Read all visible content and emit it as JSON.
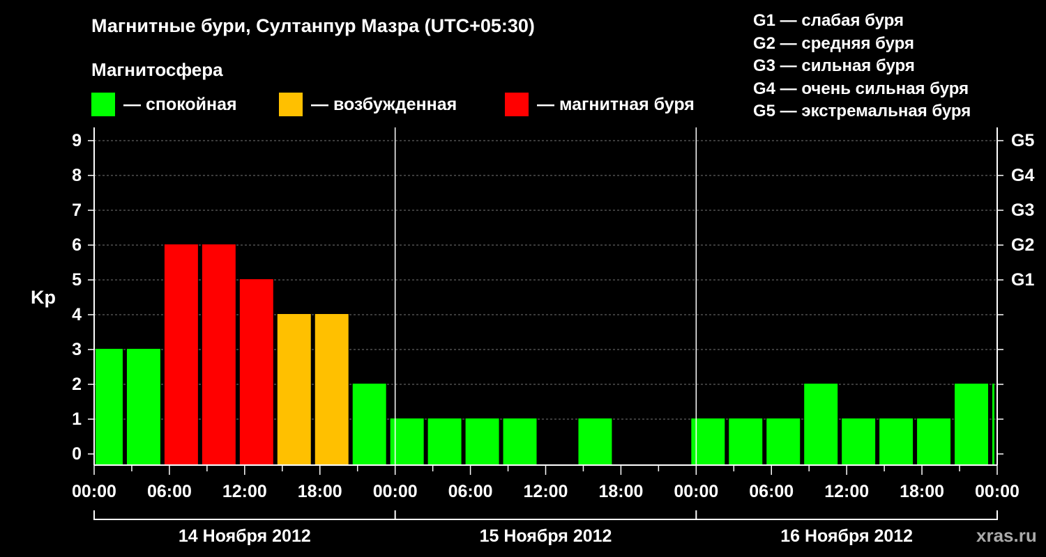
{
  "title": "Магнитные бури, Султанпур Мазра (UTC+05:30)",
  "subtitle": "Магнитосфера",
  "legend": [
    {
      "label": "— спокойная",
      "color": "#00ff00"
    },
    {
      "label": "— возбужденная",
      "color": "#ffc000"
    },
    {
      "label": "— магнитная буря",
      "color": "#ff0000"
    }
  ],
  "g_legend": [
    "G1 — слабая буря",
    "G2 — средняя буря",
    "G3 — сильная буря",
    "G4 — очень сильная буря",
    "G5 — экстремальная буря"
  ],
  "watermark": "xras.ru",
  "chart_data": {
    "type": "bar",
    "ylabel": "Kp",
    "ylim": [
      0,
      9
    ],
    "y_ticks": [
      "0",
      "1",
      "2",
      "3",
      "4",
      "5",
      "6",
      "7",
      "8",
      "9"
    ],
    "g_ticks": [
      {
        "label": "G1",
        "kp": 5
      },
      {
        "label": "G2",
        "kp": 6
      },
      {
        "label": "G3",
        "kp": 7
      },
      {
        "label": "G4",
        "kp": 8
      },
      {
        "label": "G5",
        "kp": 9
      }
    ],
    "x_ticks": [
      "00:00",
      "06:00",
      "12:00",
      "18:00",
      "00:00",
      "06:00",
      "12:00",
      "18:00",
      "00:00",
      "06:00",
      "12:00",
      "18:00",
      "00:00"
    ],
    "days": [
      "14 Ноября 2012",
      "15 Ноября 2012",
      "16 Ноября 2012"
    ],
    "hours_total": 72,
    "bars": [
      {
        "start": 0,
        "end": 2.5,
        "value": 3,
        "level": "quiet"
      },
      {
        "start": 2.5,
        "end": 5.5,
        "value": 3,
        "level": "quiet"
      },
      {
        "start": 5.5,
        "end": 8.5,
        "value": 6,
        "level": "storm"
      },
      {
        "start": 8.5,
        "end": 11.5,
        "value": 6,
        "level": "storm"
      },
      {
        "start": 11.5,
        "end": 14.5,
        "value": 5,
        "level": "storm"
      },
      {
        "start": 14.5,
        "end": 17.5,
        "value": 4,
        "level": "active"
      },
      {
        "start": 17.5,
        "end": 20.5,
        "value": 4,
        "level": "active"
      },
      {
        "start": 20.5,
        "end": 23.5,
        "value": 2,
        "level": "quiet"
      },
      {
        "start": 23.5,
        "end": 26.5,
        "value": 1,
        "level": "quiet"
      },
      {
        "start": 26.5,
        "end": 29.5,
        "value": 1,
        "level": "quiet"
      },
      {
        "start": 29.5,
        "end": 32.5,
        "value": 1,
        "level": "quiet"
      },
      {
        "start": 32.5,
        "end": 35.5,
        "value": 1,
        "level": "quiet"
      },
      {
        "start": 35.5,
        "end": 38.5,
        "value": 0,
        "level": "quiet"
      },
      {
        "start": 38.5,
        "end": 41.5,
        "value": 1,
        "level": "quiet"
      },
      {
        "start": 41.5,
        "end": 44.5,
        "value": 0,
        "level": "quiet"
      },
      {
        "start": 44.5,
        "end": 47.5,
        "value": 0,
        "level": "quiet"
      },
      {
        "start": 47.5,
        "end": 50.5,
        "value": 1,
        "level": "quiet"
      },
      {
        "start": 50.5,
        "end": 53.5,
        "value": 1,
        "level": "quiet"
      },
      {
        "start": 53.5,
        "end": 56.5,
        "value": 1,
        "level": "quiet"
      },
      {
        "start": 56.5,
        "end": 59.5,
        "value": 2,
        "level": "quiet"
      },
      {
        "start": 59.5,
        "end": 62.5,
        "value": 1,
        "level": "quiet"
      },
      {
        "start": 62.5,
        "end": 65.5,
        "value": 1,
        "level": "quiet"
      },
      {
        "start": 65.5,
        "end": 68.5,
        "value": 1,
        "level": "quiet"
      },
      {
        "start": 68.5,
        "end": 71.5,
        "value": 2,
        "level": "quiet"
      },
      {
        "start": 71.5,
        "end": 72,
        "value": 2,
        "level": "quiet"
      }
    ],
    "colors": {
      "quiet": "#00ff00",
      "active": "#ffc000",
      "storm": "#ff0000"
    },
    "grid": true,
    "legend_position": "top"
  }
}
